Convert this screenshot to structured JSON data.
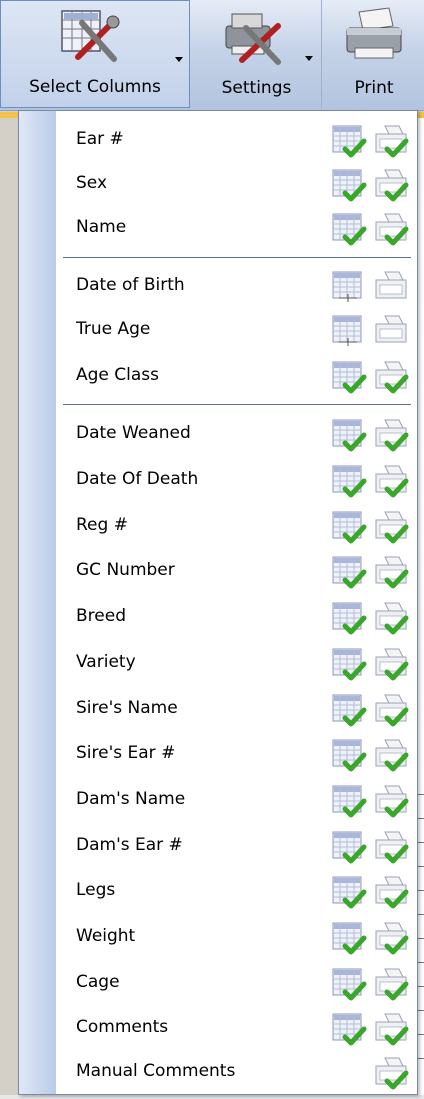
{
  "toolbar": {
    "buttons": [
      {
        "label": "Select Columns",
        "icon": "select-columns-icon",
        "has_dropdown": true,
        "active": true
      },
      {
        "label": "Settings",
        "icon": "settings-icon",
        "has_dropdown": true,
        "active": false
      },
      {
        "label": "Print",
        "icon": "printer-icon",
        "has_dropdown": false,
        "active": false
      }
    ]
  },
  "menu": {
    "items": [
      {
        "label": "Ear #",
        "grid_checked": true,
        "print_checked": true
      },
      {
        "label": "Sex",
        "grid_checked": true,
        "print_checked": true
      },
      {
        "label": "Name",
        "grid_checked": true,
        "print_checked": true
      },
      {
        "label": "Date of Birth",
        "grid_checked": false,
        "print_checked": false
      },
      {
        "label": "True Age",
        "grid_checked": false,
        "print_checked": false
      },
      {
        "label": "Age Class",
        "grid_checked": true,
        "print_checked": true
      },
      {
        "label": "Date Weaned",
        "grid_checked": true,
        "print_checked": true
      },
      {
        "label": "Date Of Death",
        "grid_checked": true,
        "print_checked": true
      },
      {
        "label": "Reg #",
        "grid_checked": true,
        "print_checked": true
      },
      {
        "label": "GC Number",
        "grid_checked": true,
        "print_checked": true
      },
      {
        "label": "Breed",
        "grid_checked": true,
        "print_checked": true
      },
      {
        "label": "Variety",
        "grid_checked": true,
        "print_checked": true
      },
      {
        "label": "Sire's Name",
        "grid_checked": true,
        "print_checked": true
      },
      {
        "label": "Sire's Ear #",
        "grid_checked": true,
        "print_checked": true
      },
      {
        "label": "Dam's Name",
        "grid_checked": true,
        "print_checked": true
      },
      {
        "label": "Dam's Ear #",
        "grid_checked": true,
        "print_checked": true
      },
      {
        "label": "Legs",
        "grid_checked": true,
        "print_checked": true
      },
      {
        "label": "Weight",
        "grid_checked": true,
        "print_checked": true
      },
      {
        "label": "Cage",
        "grid_checked": true,
        "print_checked": true
      },
      {
        "label": "Comments",
        "grid_checked": true,
        "print_checked": true
      },
      {
        "label": "Manual Comments",
        "grid_checked": null,
        "print_checked": true
      }
    ]
  },
  "colors": {
    "accent_strip": "#f6c24a",
    "check_green": "#3aa62a",
    "menu_border": "#7a8aa6"
  }
}
